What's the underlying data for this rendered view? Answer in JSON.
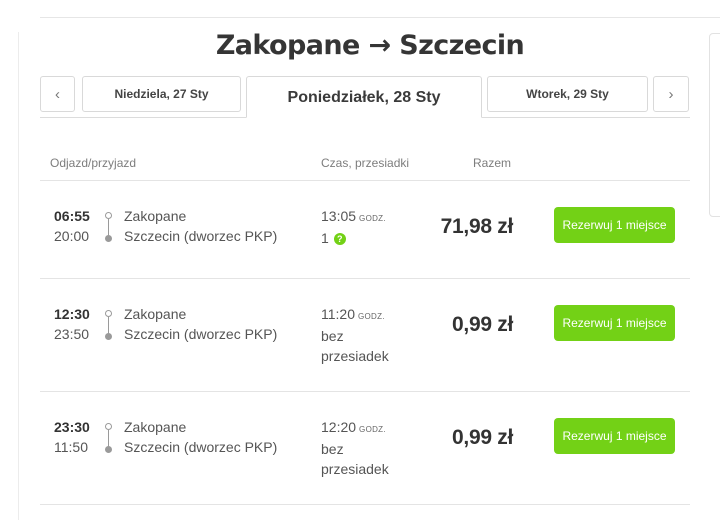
{
  "title": "Zakopane → Szczecin",
  "date_nav": {
    "prev_icon": "‹",
    "next_icon": "›",
    "prev_day": "Niedziela, 27 Sty",
    "current_day": "Poniedziałek, 28 Sty",
    "next_day": "Wtorek, 29 Sty"
  },
  "columns": {
    "departure_arrival": "Odjazd/przyjazd",
    "duration_transfers": "Czas, przesiadki",
    "total": "Razem"
  },
  "icons": {
    "help": "question-circle-icon",
    "timeline": "route-timeline-icon"
  },
  "colors": {
    "accent": "#73d116",
    "text": "#333333"
  },
  "rides": [
    {
      "departure_time": "06:55",
      "arrival_time": "20:00",
      "from": "Zakopane",
      "to": "Szczecin (dworzec PKP)",
      "duration": "13:05",
      "duration_unit": "GODZ.",
      "transfers": "1",
      "price": "71,98 zł",
      "book_label": "Rezerwuj 1 miejsce"
    },
    {
      "departure_time": "12:30",
      "arrival_time": "23:50",
      "from": "Zakopane",
      "to": "Szczecin (dworzec PKP)",
      "duration": "11:20",
      "duration_unit": "GODZ.",
      "transfers": "bez przesiadek",
      "price": "0,99 zł",
      "book_label": "Rezerwuj 1 miejsce"
    },
    {
      "departure_time": "23:30",
      "arrival_time": "11:50",
      "from": "Zakopane",
      "to": "Szczecin (dworzec PKP)",
      "duration": "12:20",
      "duration_unit": "GODZ.",
      "transfers": "bez przesiadek",
      "price": "0,99 zł",
      "book_label": "Rezerwuj 1 miejsce"
    }
  ]
}
